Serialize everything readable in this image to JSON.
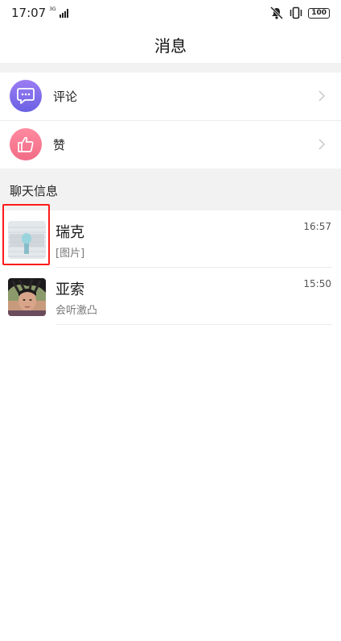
{
  "status_bar": {
    "time": "17:07",
    "network_type": "3G",
    "battery": "100"
  },
  "header": {
    "title": "消息"
  },
  "features": [
    {
      "label": "评论",
      "icon": "comment-icon",
      "color": "#7f6cee"
    },
    {
      "label": "赞",
      "icon": "thumbs-up-icon",
      "color": "#f47a92"
    }
  ],
  "section": {
    "title": "聊天信息"
  },
  "chats": [
    {
      "name": "瑞克",
      "preview": "[图片]",
      "time": "16:57",
      "avatar": "picture-avatar"
    },
    {
      "name": "亚索",
      "preview": "会听激凸",
      "time": "15:50",
      "avatar": "photo-avatar"
    }
  ],
  "colors": {
    "background": "#ffffff",
    "band": "#f2f2f2",
    "highlight": "#ff1a1a"
  }
}
